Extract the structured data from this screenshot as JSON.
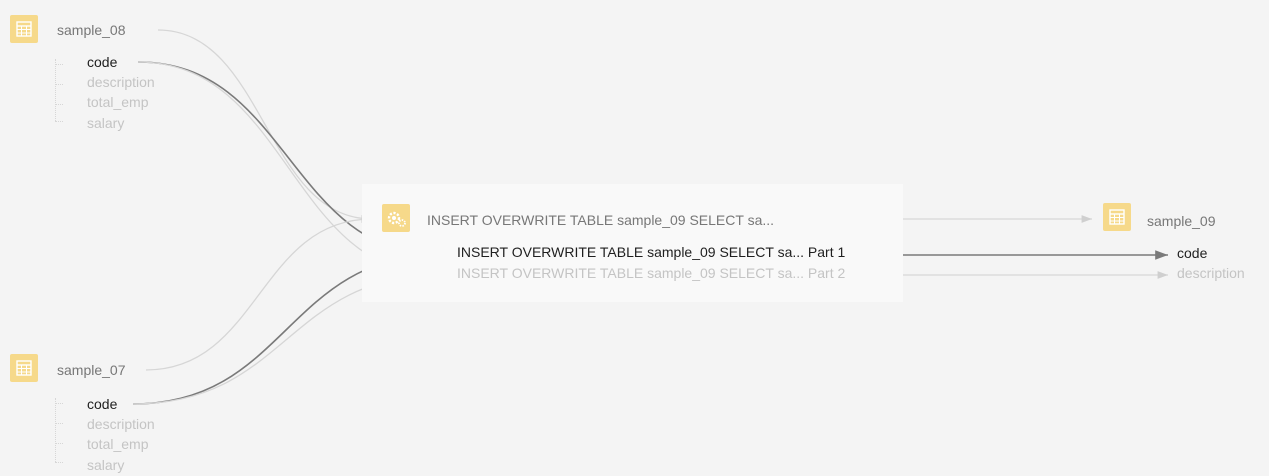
{
  "sources": [
    {
      "name": "sample_08",
      "columns": [
        {
          "label": "code",
          "active": true
        },
        {
          "label": "description",
          "active": false
        },
        {
          "label": "total_emp",
          "active": false
        },
        {
          "label": "salary",
          "active": false
        }
      ]
    },
    {
      "name": "sample_07",
      "columns": [
        {
          "label": "code",
          "active": true
        },
        {
          "label": "description",
          "active": false
        },
        {
          "label": "total_emp",
          "active": false
        },
        {
          "label": "salary",
          "active": false
        }
      ]
    }
  ],
  "process": {
    "title": "INSERT OVERWRITE TABLE sample_09 SELECT sa...",
    "parts": [
      {
        "label": "INSERT OVERWRITE TABLE sample_09 SELECT sa... Part 1",
        "active": true
      },
      {
        "label": "INSERT OVERWRITE TABLE sample_09 SELECT sa... Part 2",
        "active": false
      }
    ]
  },
  "target": {
    "name": "sample_09",
    "columns": [
      {
        "label": "code",
        "active": true
      },
      {
        "label": "description",
        "active": false
      }
    ]
  },
  "icons": {
    "table": "table-icon",
    "process": "gears-icon"
  },
  "colors": {
    "icon_bg": "#f6d98a",
    "highlight_line": "#7a7a7a",
    "dim_line": "#d6d6d6",
    "active_text": "#1f1f1f",
    "dim_text": "#c4c4c4",
    "background": "#f4f4f4"
  }
}
